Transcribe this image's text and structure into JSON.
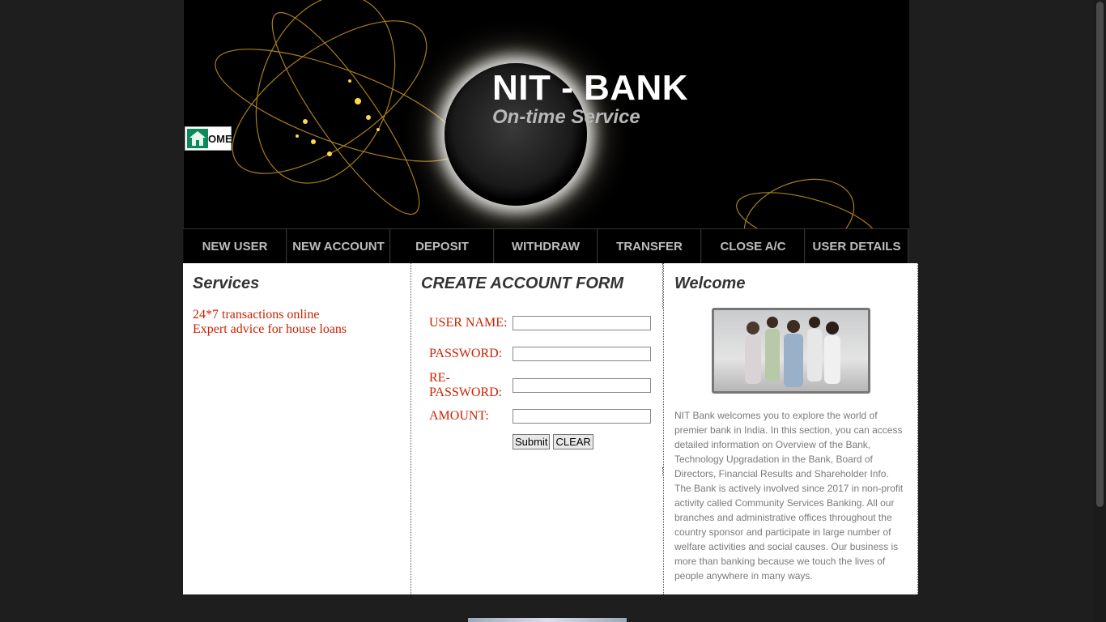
{
  "header": {
    "title": "NIT - BANK",
    "tagline": "On-time Service",
    "home_button_label": "OME",
    "home_icon": "home-icon"
  },
  "nav": {
    "items": [
      {
        "label": "NEW USER"
      },
      {
        "label": "NEW ACCOUNT"
      },
      {
        "label": "DEPOSIT"
      },
      {
        "label": "WITHDRAW"
      },
      {
        "label": "TRANSFER"
      },
      {
        "label": "CLOSE A/C"
      },
      {
        "label": "USER DETAILS"
      }
    ]
  },
  "services": {
    "heading": "Services",
    "lines": [
      "24*7 transactions online",
      "Expert advice for house loans"
    ]
  },
  "form": {
    "heading": "CREATE ACCOUNT FORM",
    "fields": [
      {
        "label": "USER NAME:",
        "value": "",
        "placeholder": ""
      },
      {
        "label": "PASSWORD:",
        "value": "",
        "placeholder": ""
      },
      {
        "label": "RE-PASSWORD:",
        "value": "",
        "placeholder": ""
      },
      {
        "label": "AMOUNT:",
        "value": "",
        "placeholder": ""
      }
    ],
    "submit_label": "Submit",
    "clear_label": "CLEAR"
  },
  "welcome": {
    "heading": "Welcome",
    "text": "NIT Bank welcomes you to explore the world of premier bank in India. In this section, you can access detailed information on Overview of the Bank, Technology Upgradation in the Bank, Board of Directors, Financial Results and Shareholder Info. The Bank is actively involved since 2017 in non-profit activity called Community Services Banking. All our branches and administrative offices throughout the country sponsor and participate in large number of welfare activities and social causes. Our business is more than banking because we touch the lives of people anywhere in many ways."
  },
  "colors": {
    "page_bg": "#1e1e1e",
    "header_bg": "#000000",
    "nav_text": "#bdbdbd",
    "accent_red": "#cc2200",
    "body_text": "#7a7a7a"
  }
}
